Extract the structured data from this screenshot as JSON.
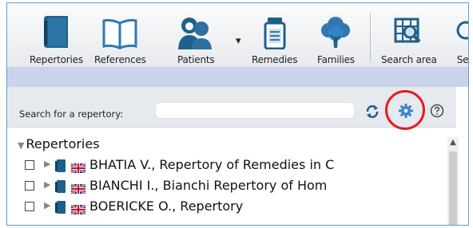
{
  "toolbar": {
    "items": [
      {
        "label": "Repertories",
        "icon": "book-icon"
      },
      {
        "label": "References",
        "icon": "open-book-icon"
      },
      {
        "label": "Patients",
        "icon": "patients-icon"
      },
      {
        "label": "Remedies",
        "icon": "remedy-jar-icon"
      },
      {
        "label": "Families",
        "icon": "tree-icon"
      },
      {
        "label": "Search area",
        "icon": "search-area-icon"
      },
      {
        "label": "Se"
      }
    ]
  },
  "search": {
    "label": "Search for a repertory:",
    "value": "",
    "placeholder": ""
  },
  "tree": {
    "header": "Repertories",
    "rows": [
      {
        "label": "BHATIA V., Repertory of Remedies in C"
      },
      {
        "label": "BIANCHI I., Bianchi Repertory of Hom"
      },
      {
        "label": "BOERICKE O., Repertory"
      }
    ]
  },
  "colors": {
    "accent": "#3a86c8",
    "highlight": "#e41d1d",
    "book": "#1e5f8c"
  }
}
